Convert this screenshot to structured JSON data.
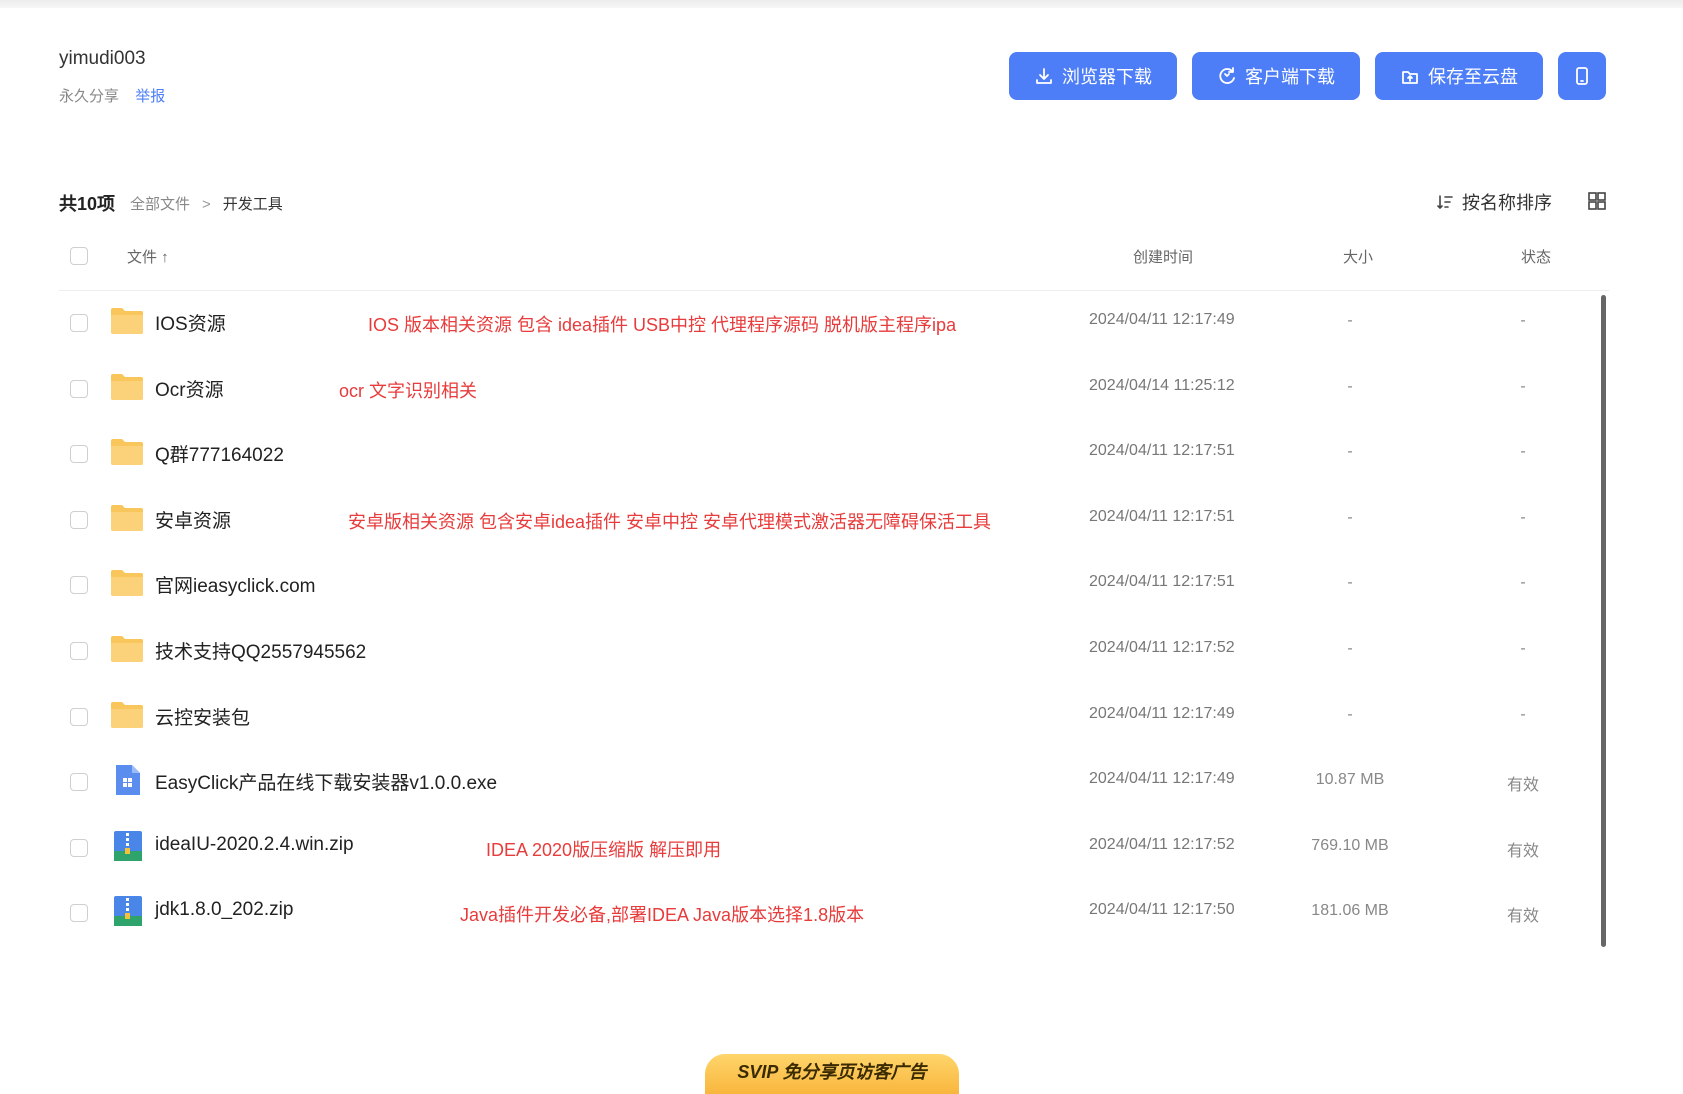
{
  "share": {
    "owner": "yimudi003",
    "permanence": "永久分享",
    "report": "举报"
  },
  "actions": {
    "browser_download": "浏览器下载",
    "client_download": "客户端下载",
    "save_cloud": "保存至云盘"
  },
  "toolbar": {
    "count": "共10项",
    "crumb_root": "全部文件",
    "crumb_sep": ">",
    "crumb_current": "开发工具",
    "sort_label": "按名称排序"
  },
  "table": {
    "col_file": "文件 ↑",
    "col_time": "创建时间",
    "col_size": "大小",
    "col_status": "状态"
  },
  "rows": [
    {
      "name": "IOS资源",
      "type": "folder",
      "note": "IOS 版本相关资源 包含 idea插件 USB中控 代理程序源码 脱机版主程序ipa",
      "time": "2024/04/11 12:17:49",
      "size": "-",
      "status": "-"
    },
    {
      "name": "Ocr资源",
      "type": "folder",
      "note": "ocr 文字识别相关",
      "time": "2024/04/14 11:25:12",
      "size": "-",
      "status": "-"
    },
    {
      "name": "Q群777164022",
      "type": "folder",
      "note": "",
      "time": "2024/04/11 12:17:51",
      "size": "-",
      "status": "-"
    },
    {
      "name": "安卓资源",
      "type": "folder",
      "note": "安卓版相关资源 包含安卓idea插件 安卓中控 安卓代理模式激活器无障碍保活工具",
      "time": "2024/04/11 12:17:51",
      "size": "-",
      "status": "-"
    },
    {
      "name": "官网ieasyclick.com",
      "type": "folder",
      "note": "",
      "time": "2024/04/11 12:17:51",
      "size": "-",
      "status": "-"
    },
    {
      "name": "技术支持QQ2557945562",
      "type": "folder",
      "note": "",
      "time": "2024/04/11 12:17:52",
      "size": "-",
      "status": "-"
    },
    {
      "name": "云控安装包",
      "type": "folder",
      "note": "",
      "time": "2024/04/11 12:17:49",
      "size": "-",
      "status": "-"
    },
    {
      "name": "EasyClick产品在线下载安装器v1.0.0.exe",
      "type": "exe",
      "note": "",
      "time": "2024/04/11 12:17:49",
      "size": "10.87 MB",
      "status": "有效"
    },
    {
      "name": "ideaIU-2020.2.4.win.zip",
      "type": "zip",
      "note": "IDEA 2020版压缩版 解压即用",
      "time": "2024/04/11 12:17:52",
      "size": "769.10 MB",
      "status": "有效"
    },
    {
      "name": "jdk1.8.0_202.zip",
      "type": "zip",
      "note": "Java插件开发必备,部署IDEA Java版本选择1.8版本",
      "time": "2024/04/11 12:17:50",
      "size": "181.06 MB",
      "status": "有效"
    }
  ],
  "ad": {
    "label": "SVIP 免分享页访客广告"
  },
  "colors": {
    "accent": "#4d7ef7",
    "note_red": "#e83b3b",
    "folder_yellow": "#f8c65a"
  }
}
